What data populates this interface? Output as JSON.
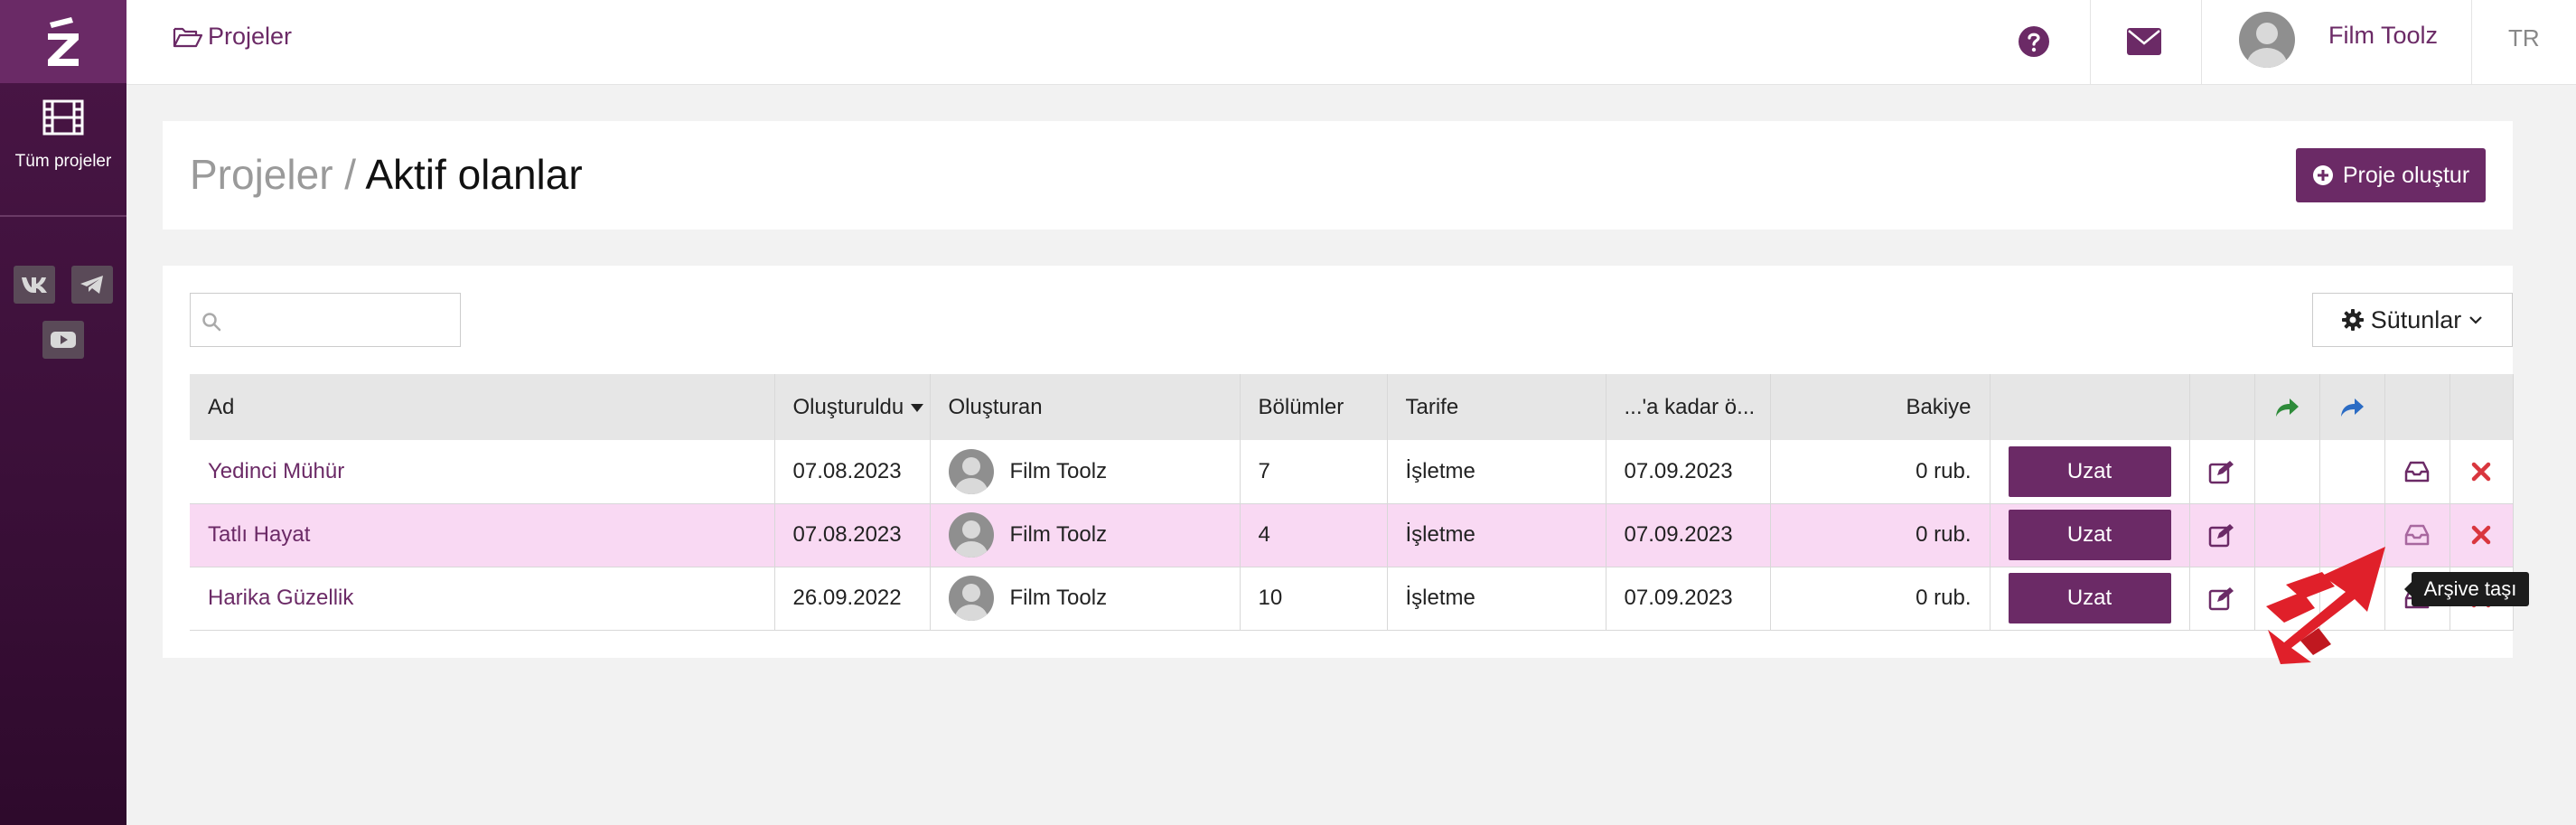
{
  "sidebar": {
    "logo_text": "Z",
    "nav": [
      {
        "label": "Tüm projeler",
        "icon": "film-icon"
      }
    ],
    "social": [
      {
        "name": "vk",
        "icon": "vk-icon"
      },
      {
        "name": "telegram",
        "icon": "telegram-icon"
      },
      {
        "name": "youtube",
        "icon": "youtube-icon"
      }
    ]
  },
  "topbar": {
    "breadcrumb": "Projeler",
    "user_name": "Film Toolz",
    "language": "TR",
    "icons": [
      "question-circle-icon",
      "envelope-icon",
      "avatar"
    ]
  },
  "header": {
    "title_parent": "Projeler /",
    "title_current": "Aktif olanlar",
    "create_button": "Proje oluştur"
  },
  "toolbar": {
    "search_placeholder": "",
    "columns_button": "Sütunlar"
  },
  "table": {
    "columns": {
      "name": "Ad",
      "created": "Oluşturuldu",
      "creator": "Oluşturan",
      "episodes": "Bölümler",
      "tariff": "Tarife",
      "paid_until": "...'a kadar ö...",
      "balance": "Bakiye"
    },
    "extend_label": "Uzat",
    "rows": [
      {
        "name": "Yedinci Mühür",
        "created": "07.08.2023",
        "creator": "Film Toolz",
        "episodes": "7",
        "tariff": "İşletme",
        "paid_until": "07.09.2023",
        "balance": "0 rub."
      },
      {
        "name": "Tatlı Hayat",
        "created": "07.08.2023",
        "creator": "Film Toolz",
        "episodes": "4",
        "tariff": "İşletme",
        "paid_until": "07.09.2023",
        "balance": "0 rub."
      },
      {
        "name": "Harika Güzellik",
        "created": "26.09.2022",
        "creator": "Film Toolz",
        "episodes": "10",
        "tariff": "İşletme",
        "paid_until": "07.09.2023",
        "balance": "0 rub."
      }
    ]
  },
  "tooltip": "Arşive taşı",
  "colors": {
    "brand": "#6b2a66",
    "sidebar_bg": "#3a0f38",
    "row_highlight": "#f9d9f3",
    "share_green": "#2e8b3a",
    "share_blue": "#2b6cc4",
    "delete_red": "#d9363e",
    "pointer_red": "#e0202a"
  }
}
